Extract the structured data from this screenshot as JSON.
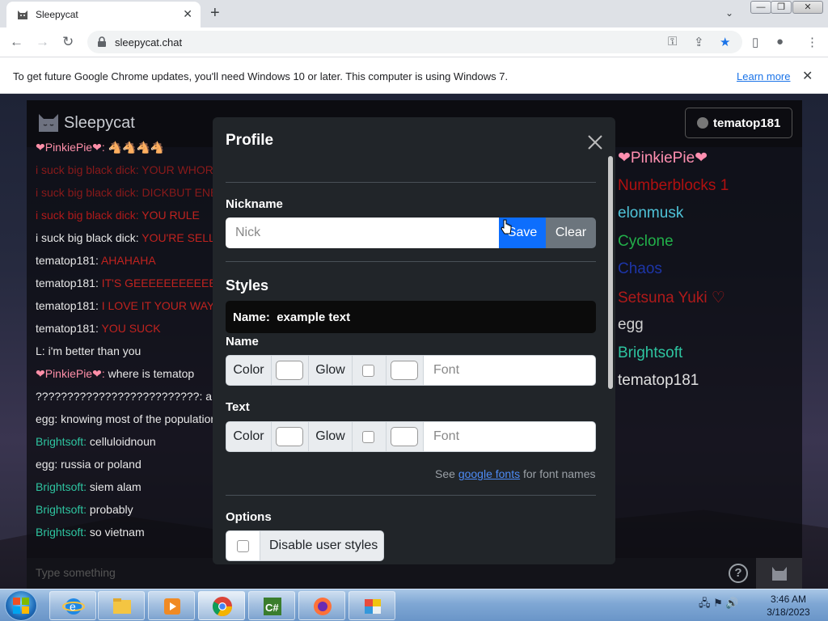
{
  "browser": {
    "tab_title": "Sleepycat",
    "tab_close_icon": "close-icon",
    "new_tab_icon": "plus-icon",
    "url": "sleepycat.chat",
    "infobar_message": "To get future Google Chrome updates, you'll need Windows 10 or later. This computer is using Windows 7.",
    "infobar_link": "Learn more"
  },
  "app": {
    "brand": "Sleepycat",
    "user_button": "tematop181",
    "composer_placeholder": "Type something",
    "help_label": "?"
  },
  "chat_messages": [
    {
      "nick": "❤PinkiePie❤",
      "sep": ": ",
      "text": "🐴🐴🐴🐴",
      "nick_color": "#ff8fa8",
      "text_color": "#8a1a2a"
    },
    {
      "nick": "i suck big black dick",
      "sep": ": ",
      "text": "YOUR WHOREHOMES",
      "nick_color": "#8a1a1a",
      "text_color": "#8a1a1a"
    },
    {
      "nick": "i suck big black dick",
      "sep": ": ",
      "text": "DICKBUT ENERGIES",
      "nick_color": "#8a1a1a",
      "text_color": "#8a1a1a"
    },
    {
      "nick": "i suck big black dick",
      "sep": ": ",
      "text": "YOU RULE",
      "nick_color": "#b01a1a",
      "text_color": "#c0231f"
    },
    {
      "nick": "i suck big black dick",
      "sep": ": ",
      "text": "YOU'RE SELLING THE",
      "nick_color": "#e8e8e8",
      "text_color": "#c0231f"
    },
    {
      "nick": "tematop181",
      "sep": ": ",
      "text": "AHAHAHA",
      "nick_color": "#e8e8e8",
      "text_color": "#c0231f"
    },
    {
      "nick": "tematop181",
      "sep": ": ",
      "text": "IT'S GEEEEEEEEEEEEEEEE YAY",
      "nick_color": "#e8e8e8",
      "text_color": "#c0231f"
    },
    {
      "nick": "tematop181",
      "sep": ": ",
      "text": "I LOVE IT YOUR WAY",
      "nick_color": "#e8e8e8",
      "text_color": "#c0231f"
    },
    {
      "nick": "tematop181",
      "sep": ": ",
      "text": "YOU SUCK",
      "nick_color": "#e8e8e8",
      "text_color": "#c0231f"
    },
    {
      "nick": "L",
      "sep": ": ",
      "text": "i'm better than you",
      "nick_color": "#e8e8e8",
      "text_color": "#e8e8e8"
    },
    {
      "nick": "❤PinkiePie❤",
      "sep": ": ",
      "text": "where is tematop",
      "nick_color": "#ff8fa8",
      "text_color": "#e8e8e8"
    },
    {
      "nick": "??????????????????????????",
      "sep": ": ",
      "text": "a",
      "nick_color": "#e8e8e8",
      "text_color": "#e8e8e8"
    },
    {
      "nick": "egg",
      "sep": ": ",
      "text": "knowing most of the population",
      "nick_color": "#e8e8e8",
      "text_color": "#e8e8e8"
    },
    {
      "nick": "Brightsoft",
      "sep": ": ",
      "text": "celluloidnoun",
      "nick_color": "#2ec4a0",
      "text_color": "#e8e8e8"
    },
    {
      "nick": "egg",
      "sep": ": ",
      "text": "russia or poland",
      "nick_color": "#e8e8e8",
      "text_color": "#e8e8e8"
    },
    {
      "nick": "Brightsoft",
      "sep": ": ",
      "text": "siem alam",
      "nick_color": "#2ec4a0",
      "text_color": "#e8e8e8"
    },
    {
      "nick": "Brightsoft",
      "sep": ": ",
      "text": "probably",
      "nick_color": "#2ec4a0",
      "text_color": "#e8e8e8"
    },
    {
      "nick": "Brightsoft",
      "sep": ": ",
      "text": "so vietnam",
      "nick_color": "#2ec4a0",
      "text_color": "#e8e8e8"
    }
  ],
  "user_list": [
    {
      "name": "❤PinkiePie❤",
      "color": "#ff8fb0"
    },
    {
      "name": "Numberblocks 1",
      "color": "#b01010"
    },
    {
      "name": "elonmusk",
      "color": "#4fc3d8"
    },
    {
      "name": "Cyclone",
      "color": "#22b04a"
    },
    {
      "name": "Chaos",
      "color": "#1d35a8"
    },
    {
      "name": "Setsuna Yuki ♡",
      "color": "#b01a1a"
    },
    {
      "name": "egg",
      "color": "#d0d0d0"
    },
    {
      "name": "Brightsoft",
      "color": "#2ec4a0"
    },
    {
      "name": "tematop181",
      "color": "#e0e0e0"
    }
  ],
  "modal": {
    "title": "Profile",
    "close_icon": "close-icon",
    "nickname_label": "Nickname",
    "nick_placeholder": "Nick",
    "save_label": "Save",
    "clear_label": "Clear",
    "styles_title": "Styles",
    "preview_name": "Name:",
    "preview_text": "example text",
    "name_label": "Name",
    "text_label": "Text",
    "color_label": "Color",
    "glow_label": "Glow",
    "font_placeholder": "Font",
    "hint_prefix": "See ",
    "hint_link": "google fonts",
    "hint_suffix": " for font names",
    "options_title": "Options",
    "disable_styles_label": "Disable user styles"
  },
  "taskbar": {
    "apps": [
      "start",
      "internet-explorer",
      "file-explorer",
      "media-player",
      "chrome",
      "csharp-editor",
      "firefox",
      "control-panel"
    ],
    "time": "3:46 AM",
    "date": "3/18/2023"
  },
  "colors": {
    "primary": "#0d6efd",
    "secondary": "#6c757d",
    "modal_bg": "#212529",
    "link": "#4d8bf5"
  }
}
